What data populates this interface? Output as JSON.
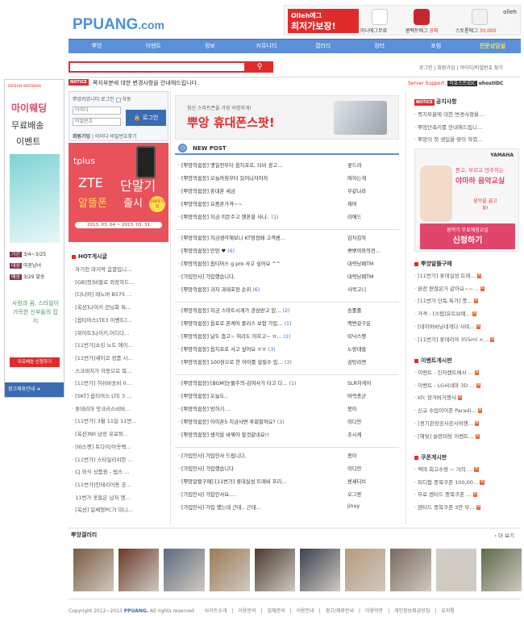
{
  "logo": {
    "brand": "PPUANG",
    "suffix": ".com"
  },
  "top_ad": {
    "headline_1": "Olleh에그",
    "headline_2": "최저가보장!",
    "products": [
      {
        "label": "미니에그무료",
        "color": "#ffffff"
      },
      {
        "label": "콤팩트에그",
        "sub": "공짜",
        "color": "#c8262f"
      },
      {
        "label": "스토롱에그",
        "price": "30,000",
        "color": "#f1f1f1"
      }
    ],
    "carrier": "olleh"
  },
  "nav": [
    "뿌앙",
    "이벤트",
    "정보",
    "커뮤니티",
    "갤러리",
    "장터",
    "포럼",
    "전문상담실"
  ],
  "search": {
    "value": "",
    "button_icon": "search-icon"
  },
  "top_links": [
    "로그인",
    "회원가입",
    "아이디/비밀번호 찾기"
  ],
  "notice_bar": {
    "badge": "NOTICE",
    "text": "쪽지부분에 대한 변경사항을 안내해드립니다.",
    "server_label": "Server Support:",
    "server_text": "이호스트IDC",
    "server_logo": "ehostIDC"
  },
  "left_ad": {
    "brand": "DESIGN WEDDING",
    "title_1": "마이웨딩",
    "title_2": "무료배송",
    "title_3": "이벤트",
    "info": [
      {
        "k": "기간",
        "v": "3/4~3/25"
      },
      {
        "k": "대상",
        "v": "미혼남녀"
      },
      {
        "k": "배송",
        "v": "3/29 발송"
      }
    ],
    "slogan": "사랑과 꿈, 스타일이 가득한 신부들의 잡지",
    "cta": "무료배송 신청하기",
    "footer": "광고제휴안내"
  },
  "login": {
    "title": "뿌앙커뮤니티 로그인",
    "auto": "자동",
    "id_placeholder": "아이디",
    "pw_placeholder": "비밀번호",
    "button": "로그인",
    "register": "회원가입",
    "find": "아이디·비밀번호찾기"
  },
  "zte_ad": {
    "brand": "tplus",
    "title_1": "ZTE",
    "title_2": "단말기",
    "title_3": "알뜰폰",
    "title_4": "출시",
    "badge": "100대 한정",
    "dates": "2013. 03. 04 ~ 2013. 03. 31"
  },
  "hot": {
    "title": "HOT게시글",
    "items": [
      "자기전 마지막 음깔입니…",
      "[GB]컷]비팔로 외장하드…",
      "[다나와] 레노버 B575 …",
      "[옥션]나이키 런닝화 특…",
      "[옵티머스LTE3 이벤트]…",
      "[위아트]나이키,이디다…",
      "[11번가]쇼킹 노트 에이…",
      "[11번가]세이코 정품 시…",
      "스크래치가 자동으로 복…",
      "[11번가] 허쉬바송비 0…",
      "[SKT] 옵티머스 LTE 3 …",
      "롯데리아 맛크러스비버…",
      "[11번가] 3월 11일 11번…",
      "[옥션]NII 남성 유료퇴…",
      "[바스켓] 토다이/아웃백…",
      "[11번가] 스타일리쉬한 …",
      "CJ 외식 상품권 - 빕스 …",
      "[11번가]인테리어용 공…",
      "11번가 옷들은 남자 엔…",
      "[옥션] 일체형PC가 미니…"
    ]
  },
  "banner": {
    "line_1": "최신 스마트폰을 가장 저렴하게!",
    "line_2": "뿌앙 휴대폰스팟!"
  },
  "new_post": {
    "title": "NEW POST",
    "groups": [
      [
        {
          "title": "[뿌앙의쉼장] 옛일전부터 옵지포로, 티비 광고…",
          "author": "꽃드려"
        },
        {
          "title": "[뿌앙의쉼장] 오늘아침부터 읽어나자마자",
          "author": "며하는게"
        },
        {
          "title": "[뿌앙의쉼장] 휴대폰 세금",
          "author": "무같나라"
        },
        {
          "title": "[뿌앙의쉼장] 요즘폰가격~~",
          "author": "재여"
        },
        {
          "title": "[뿌앙의쉼장] 지금 이돈주고 핸폰을 사나..",
          "count": "(1)",
          "author": "라에드"
        }
      ],
      [
        {
          "title": "[뿌앙의쉼장] 지금생각해보니 KT영정패 고객센…",
          "author": "감자감자"
        },
        {
          "title": "[뿌앙의쉼장] 민망 ♥",
          "count": "(6)",
          "author": "뽀뽀야와의전…"
        },
        {
          "title": "[뿌앙의쉼장] 옵티머스 g pro 사고 싶어요 ^^",
          "author": "대략낭패TM"
        },
        {
          "title": "[가입인사] 가입했습니다.",
          "author": "대략낭패TM"
        },
        {
          "title": "[뿌앙의쉼장] 과자 과태포장 순위",
          "count": "(6)",
          "author": "사북고니"
        }
      ],
      [
        {
          "title": "[뿌앙의쉼장] 지금 스마트시계가 관심받고 있…",
          "count": "(2)",
          "author": "송롤롤"
        },
        {
          "title": "[뿌앙의쉼장] 옵포로 폰케어 플러스 보험 가입…",
          "count": "(1)",
          "author": "백변갈구운"
        },
        {
          "title": "[뿌앙의쉼장] 날도 춥고~ 허리도 아프고~ ㅠ…",
          "count": "(1)",
          "author": "띠닉스쨩"
        },
        {
          "title": "[뿌앙의쉼장] 옵지포로 사고 싶어요 ㅠㅠ",
          "count": "(3)",
          "author": "노랑대발"
        },
        {
          "title": "[뿌앙의쉼장] 100원으로 한 아이를 살릴수 있…",
          "count": "(3)",
          "author": "곰탕라면"
        }
      ],
      [
        {
          "title": "[뿌앙의쉼장] [BGM]눈물주의-김여사가 타고 다…",
          "count": "(1)",
          "author": "SLR자게이"
        },
        {
          "title": "[뿌앙의쉼장] 오늘도..",
          "author": "버럭종군"
        },
        {
          "title": "[뿌앙의쉼장] 방하기....",
          "author": "몽이"
        },
        {
          "title": "[뿌앙의쉼장] 아이폰5 지금사면 후회할까요?",
          "count": "(3)",
          "author": "이디안"
        },
        {
          "title": "[뿌앙의쉼장] 생각을 바꿔야 할것같네요!!",
          "author": "조시케"
        }
      ],
      [
        {
          "title": "[가입인사] 가입인사 드립니다.",
          "author": "몽이"
        },
        {
          "title": "[가입인사] 가입했습니다",
          "author": "이디안"
        },
        {
          "title": "[뿌앙알뜰구매] [11번가] 롯데실성 트레비 프리…",
          "author": "센세티브"
        },
        {
          "title": "[가입인사] 가입인사요....",
          "author": "오그랑"
        },
        {
          "title": "[가입인사] 가입 했는데 근데.. 근데…",
          "author": "jinuy"
        }
      ]
    ]
  },
  "right_notice": {
    "badge": "NOTICE",
    "title": "공지사항",
    "items": [
      "쪽지부분에 대한 변경사항을…",
      "뿌앙단축키를 안내해드립니…",
      "뿌앙이 첫 생일을 맞이 하였…"
    ]
  },
  "right_ad": {
    "brand": "YAMAHA",
    "line_1": "듣고, 부르고 연주하는",
    "line_2": "야마하 음악교실",
    "line_3": "음악을 골고루!",
    "sub": "봄학기 무료체험교실",
    "cta": "신청하기"
  },
  "right_sections": [
    {
      "title": "뿌앙알뜰구매",
      "items": [
        "[11번가] 롯데실성 트레…",
        "완전 편찮은거 같아요~~…",
        "[11번가 단독 특가] 풍…",
        "가격 - [스텝]유트브랙…",
        "[네이버바닝네게다 사띠…",
        "[11번가] 롯데리아 355ml ×…"
      ]
    },
    {
      "title": "이벤트게시판",
      "items": [
        "이벤트 - 진자렌트에서 …",
        "이벤트 - LG씨네마 3D …",
        "kfc 장거버거행사",
        "신규 수입이어폰 Paradi…",
        "[경기관광공사공사여행…",
        "[해빛] 슬판미팅 이벤트…"
      ]
    },
    {
      "title": "쿠폰게시판",
      "items": [
        "맥며 회고수량 ~ 거의 …",
        "피디팝 중복쿠폰 100,00…",
        "무료 렌터드 중복쿠폰 …",
        "렌터드 중복쿠폰 3만 무…"
      ]
    }
  ],
  "gallery": {
    "title": "뿌앙갤러리",
    "more": "더 보기",
    "thumbs": [
      "#7a5a40",
      "#6b3a2a",
      "#5c6b7e",
      "#9c7a55",
      "#4a3a30",
      "#3b4250",
      "#b89a7a",
      "#7a6a60",
      "#d0ccc6",
      "#5b6a4a"
    ]
  },
  "footer": {
    "copyright_pre": "Copyright 2012~2013",
    "copyright_brand": "PPUANG.",
    "copyright_post": "All rights reserved",
    "links": [
      "사이트소개",
      "이용문의",
      "업체문의",
      "이용안내",
      "광고/제휴안내",
      "이용약관",
      "개인정보취급방침",
      "유지통"
    ]
  }
}
